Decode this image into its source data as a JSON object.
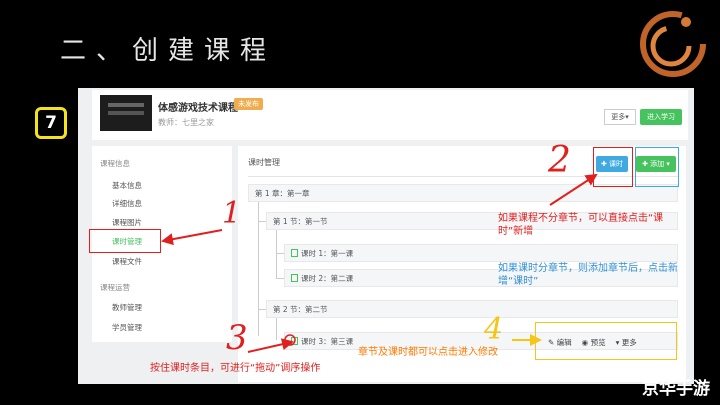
{
  "slide": {
    "title": "二、创建课程",
    "step": "7",
    "footer_logo": "京华手游"
  },
  "course": {
    "name": "体感游戏技术课程",
    "status_badge": "未发布",
    "teacher": "教师：七里之家",
    "more_label": "更多▾",
    "goto_label": "进入学习"
  },
  "sidebar": {
    "group1": "课程信息",
    "items1": [
      "基本信息",
      "详细信息",
      "课程图片",
      "课时管理",
      "课程文件"
    ],
    "group2": "课程运营",
    "items2": [
      "教师管理",
      "学员管理"
    ]
  },
  "main": {
    "title": "课时管理",
    "lesson_btn": "✚ 课时",
    "add_btn": "✚ 添加 ▾",
    "tree": {
      "chapter1": "第 1 章：第一章",
      "section1": "第 1 节：第一节",
      "lesson1": "课时 1：第一课",
      "lesson2": "课时 2：第二课",
      "section2": "第 2 节：第二节",
      "lesson3": "课时 3：第三课"
    },
    "actions": {
      "edit": "✎ 编辑",
      "preview": "◉ 预览",
      "more": "▾ 更多"
    }
  },
  "annotations": {
    "num1": "1",
    "num2": "2",
    "num3": "3",
    "num4": "4",
    "text_red": "如果课程不分章节，可以直接点击“课时”新增",
    "text_blue": "如果课时分章节，则添加章节后，点击新增“课时”",
    "text_orange": "章节及课时都可以点击进入修改",
    "text_drag": "按住课时条目，可进行“拖动”调序操作"
  },
  "colors": {
    "red": "#e0201f",
    "blue": "#3fa9e0",
    "green": "#46c35f",
    "yellow": "#f5c518",
    "orange": "#ff7a00"
  }
}
